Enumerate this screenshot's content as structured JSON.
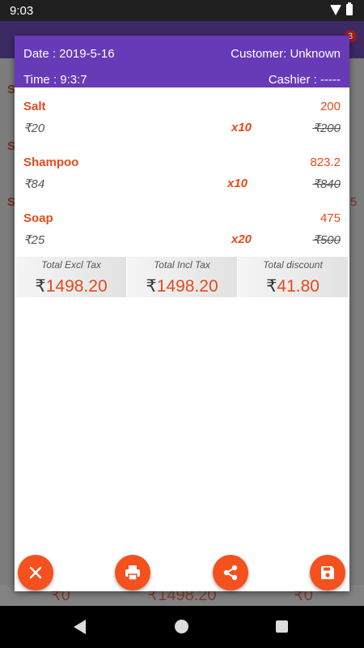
{
  "status_bar": {
    "time": "9:03"
  },
  "background": {
    "badge": "3",
    "side_letters": [
      "S",
      "S",
      "S"
    ],
    "side_right": [
      "5"
    ],
    "bottom_values": [
      "₹0",
      "₹1498.20",
      "₹0"
    ]
  },
  "header": {
    "date": "Date : 2019-5-16",
    "customer": "Customer: Unknown",
    "time": "Time : 9:3:7",
    "cashier": "Cashier : -----"
  },
  "items": [
    {
      "name": "Salt",
      "total": "200",
      "price": "₹20",
      "qty": "x10",
      "original": "₹200"
    },
    {
      "name": "Shampoo",
      "total": "823.2",
      "price": "₹84",
      "qty": "x10",
      "original": "₹840"
    },
    {
      "name": "Soap",
      "total": "475",
      "price": "₹25",
      "qty": "x20",
      "original": "₹500"
    }
  ],
  "totals": [
    {
      "label": "Total Excl Tax",
      "symbol": "₹",
      "value": "1498.20"
    },
    {
      "label": "Total Incl Tax",
      "symbol": "₹",
      "value": "1498.20"
    },
    {
      "label": "Total discount",
      "symbol": "₹",
      "value": "41.80"
    }
  ],
  "actions": {
    "close_icon": "close-icon",
    "print_icon": "print-icon",
    "share_icon": "share-icon",
    "save_icon": "save-icon"
  },
  "colors": {
    "accent": "#673ab7",
    "highlight": "#e64a19",
    "fab": "#f4511e"
  }
}
